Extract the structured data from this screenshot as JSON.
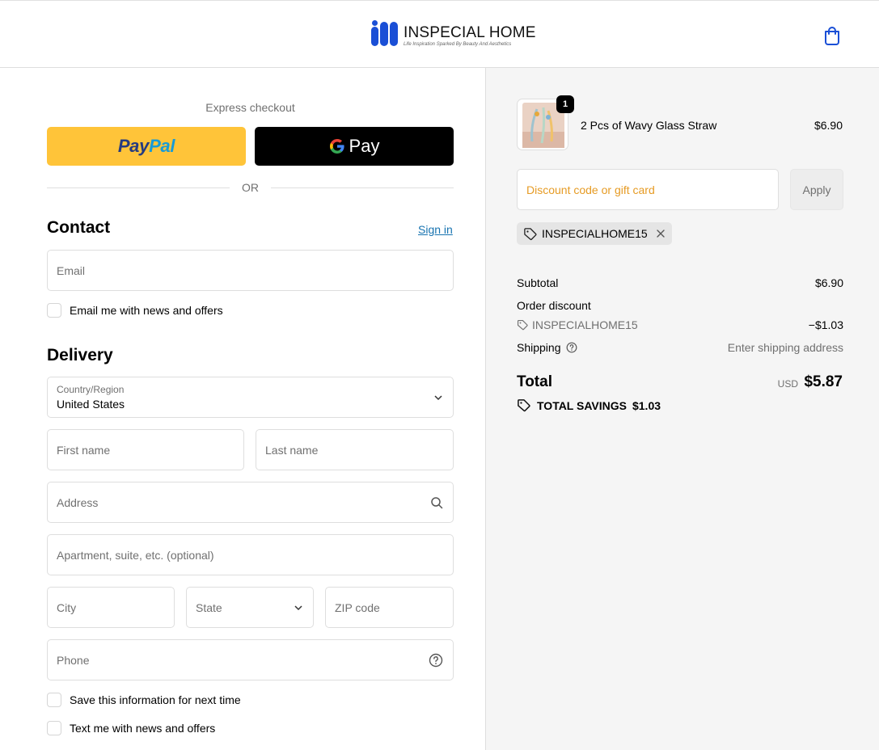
{
  "header": {
    "brand_name": "INSPECIAL HOME",
    "brand_tagline": "Life Inspiration Sparked By Beauty And Aesthetics",
    "cart_icon": "shopping-bag-icon"
  },
  "express": {
    "label": "Express checkout",
    "paypal_part1": "Pay",
    "paypal_part2": "Pal",
    "gpay_label": "Pay",
    "or_text": "OR"
  },
  "contact": {
    "title": "Contact",
    "sign_in": "Sign in",
    "email_placeholder": "Email",
    "news_checkbox": "Email me with news and offers"
  },
  "delivery": {
    "title": "Delivery",
    "country_label": "Country/Region",
    "country_value": "United States",
    "first_name": "First name",
    "last_name": "Last name",
    "address": "Address",
    "apartment": "Apartment, suite, etc. (optional)",
    "city": "City",
    "state": "State",
    "zip": "ZIP code",
    "phone": "Phone",
    "save_info": "Save this information for next time",
    "text_me": "Text me with news and offers"
  },
  "summary": {
    "product": {
      "quantity": "1",
      "name": "2 Pcs of Wavy Glass Straw",
      "price": "$6.90"
    },
    "discount_placeholder": "Discount code or gift card",
    "apply_label": "Apply",
    "applied_code": "INSPECIALHOME15",
    "subtotal_label": "Subtotal",
    "subtotal_value": "$6.90",
    "order_discount_label": "Order discount",
    "discount_code": "INSPECIALHOME15",
    "discount_value": "−$1.03",
    "shipping_label": "Shipping",
    "shipping_value": "Enter shipping address",
    "total_label": "Total",
    "currency": "USD",
    "total_value": "$5.87",
    "savings_label": "TOTAL SAVINGS",
    "savings_value": "$1.03"
  },
  "colors": {
    "paypal_yellow": "#ffc439",
    "link_blue": "#1773b0",
    "brand_blue": "#1a4fd6",
    "placeholder_orange": "#e69b24"
  }
}
